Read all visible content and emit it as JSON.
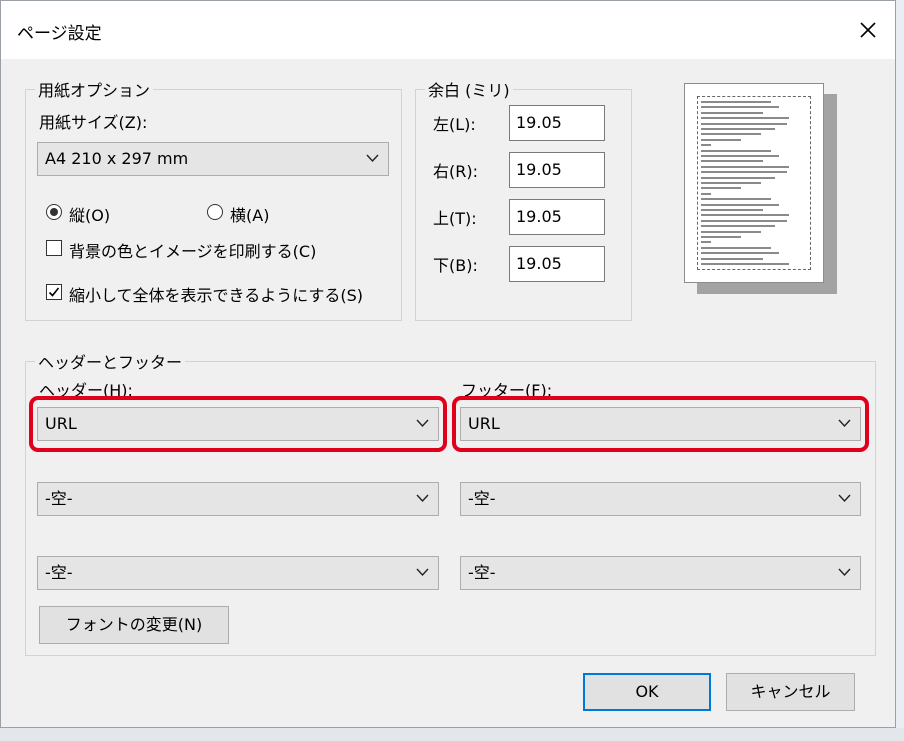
{
  "window": {
    "title": "ページ設定"
  },
  "paper_options": {
    "legend": "用紙オプション",
    "size_label": "用紙サイズ(Z):",
    "size_value": "A4 210 x 297 mm",
    "portrait_label": "縦(O)",
    "portrait_selected": true,
    "landscape_label": "横(A)",
    "landscape_selected": false,
    "print_background_label": "背景の色とイメージを印刷する(C)",
    "print_background_checked": false,
    "shrink_to_fit_label": "縮小して全体を表示できるようにする(S)",
    "shrink_to_fit_checked": true
  },
  "margins": {
    "legend": "余白 (ミリ)",
    "left_label": "左(L):",
    "left_value": "19.05",
    "right_label": "右(R):",
    "right_value": "19.05",
    "top_label": "上(T):",
    "top_value": "19.05",
    "bottom_label": "下(B):",
    "bottom_value": "19.05"
  },
  "headers_footers": {
    "legend": "ヘッダーとフッター",
    "header_label": "ヘッダー(H):",
    "footer_label": "フッター(F):",
    "header_values": [
      "URL",
      "-空-",
      "-空-"
    ],
    "footer_values": [
      "URL",
      "-空-",
      "-空-"
    ],
    "font_button": "フォントの変更(N)"
  },
  "buttons": {
    "ok": "OK",
    "cancel": "キャンセル"
  },
  "colors": {
    "highlight": "#e0001b",
    "default_button_border": "#0078d7"
  }
}
